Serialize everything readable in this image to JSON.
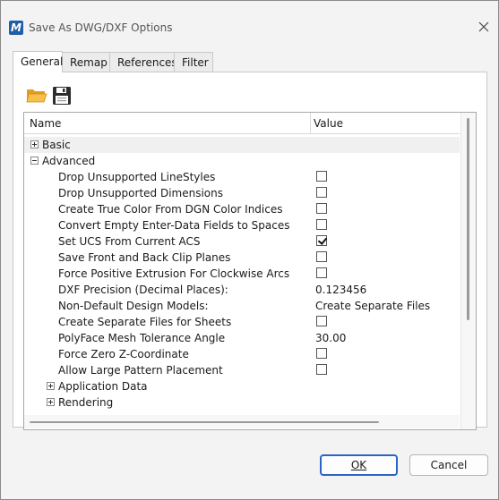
{
  "window": {
    "title": "Save As DWG/DXF Options",
    "app_icon_letter": "M"
  },
  "tabs": [
    {
      "label": "General",
      "active": true
    },
    {
      "label": "Remap",
      "active": false
    },
    {
      "label": "References",
      "active": false
    },
    {
      "label": "Filter",
      "active": false
    }
  ],
  "toolbar": {
    "open_icon": "folder-open-icon",
    "save_icon": "floppy-disk-icon"
  },
  "grid": {
    "columns": {
      "name": "Name",
      "value": "Value"
    },
    "groups": {
      "basic": "Basic",
      "advanced": "Advanced",
      "application_data": "Application Data",
      "rendering": "Rendering"
    },
    "advanced_rows": [
      {
        "label": "Drop Unsupported LineStyles",
        "type": "checkbox",
        "checked": false
      },
      {
        "label": "Drop Unsupported Dimensions",
        "type": "checkbox",
        "checked": false
      },
      {
        "label": "Create True Color From DGN Color Indices",
        "type": "checkbox",
        "checked": false
      },
      {
        "label": "Convert Empty Enter-Data Fields to Spaces",
        "type": "checkbox",
        "checked": false
      },
      {
        "label": "Set UCS From Current ACS",
        "type": "checkbox",
        "checked": true
      },
      {
        "label": "Save Front and Back Clip Planes",
        "type": "checkbox",
        "checked": false
      },
      {
        "label": "Force Positive Extrusion For Clockwise Arcs",
        "type": "checkbox",
        "checked": false
      },
      {
        "label": "DXF Precision (Decimal Places):",
        "type": "text",
        "value": "0.123456"
      },
      {
        "label": "Non-Default Design Models:",
        "type": "text",
        "value": "Create Separate Files"
      },
      {
        "label": "Create Separate Files for Sheets",
        "type": "checkbox",
        "checked": false
      },
      {
        "label": "PolyFace Mesh Tolerance Angle",
        "type": "text",
        "value": "30.00"
      },
      {
        "label": "Force Zero Z-Coordinate",
        "type": "checkbox",
        "checked": false
      },
      {
        "label": "Allow Large Pattern Placement",
        "type": "checkbox",
        "checked": false
      }
    ]
  },
  "buttons": {
    "ok": "OK",
    "cancel": "Cancel"
  },
  "colors": {
    "accent": "#2b64c7",
    "folder": "#f2b233",
    "disk": "#2d2d2d"
  }
}
